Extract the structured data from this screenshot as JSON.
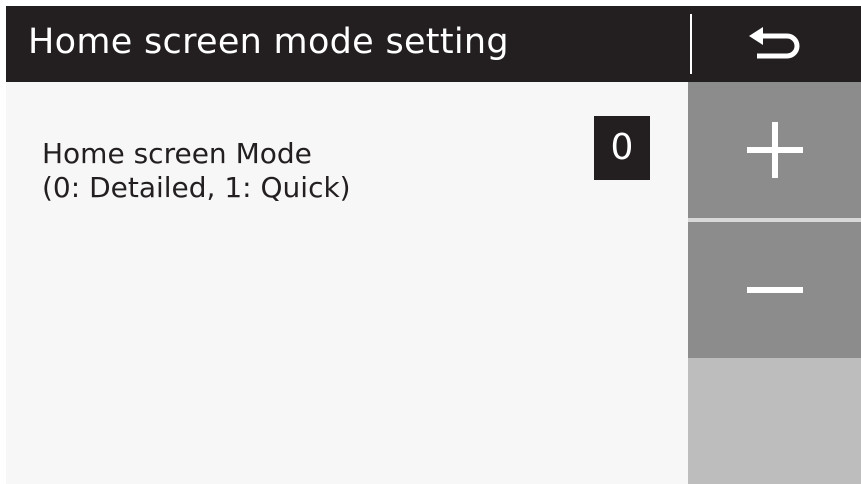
{
  "header": {
    "title": "Home screen mode setting",
    "back_icon": "return-arrow-icon"
  },
  "setting": {
    "label_line1": "Home screen Mode",
    "label_line2": "(0: Detailed, 1: Quick)",
    "value": "0"
  },
  "controls": {
    "increment_icon": "plus-icon",
    "decrement_icon": "minus-icon"
  },
  "colors": {
    "header_bg": "#231f20",
    "content_bg": "#f7f7f7",
    "button_bg": "#8c8c8c",
    "side_panel_bg": "#bdbdbd",
    "value_bg": "#231f20"
  }
}
